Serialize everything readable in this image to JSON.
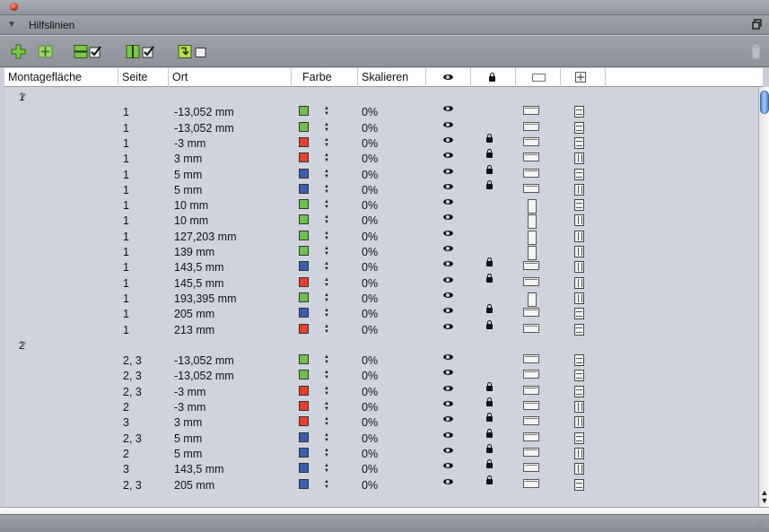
{
  "panel": {
    "title": "Hilfslinien"
  },
  "columns": {
    "montage": "Montagefläche",
    "seite": "Seite",
    "ort": "Ort",
    "farbe": "Farbe",
    "skalieren": "Skalieren",
    "view_icon": "eye-icon",
    "lock_icon": "lock-icon",
    "orient_icon": "orientation-icon",
    "spread_icon": "spread-icon"
  },
  "colors": {
    "green": "#6cc24a",
    "red": "#e8402a",
    "blue": "#3a5eb0"
  },
  "groups": [
    {
      "label": "1",
      "rows": [
        {
          "seite": "1",
          "ort": "-13,052 mm",
          "color": "green",
          "scale": "0%",
          "lock": false,
          "ori": "h",
          "spr": "h"
        },
        {
          "seite": "1",
          "ort": "-13,052 mm",
          "color": "green",
          "scale": "0%",
          "lock": false,
          "ori": "h",
          "spr": "h"
        },
        {
          "seite": "1",
          "ort": "-3 mm",
          "color": "red",
          "scale": "0%",
          "lock": true,
          "ori": "h",
          "spr": "h"
        },
        {
          "seite": "1",
          "ort": "3 mm",
          "color": "red",
          "scale": "0%",
          "lock": true,
          "ori": "h",
          "spr": "v"
        },
        {
          "seite": "1",
          "ort": "5 mm",
          "color": "blue",
          "scale": "0%",
          "lock": true,
          "ori": "h",
          "spr": "h"
        },
        {
          "seite": "1",
          "ort": "5 mm",
          "color": "blue",
          "scale": "0%",
          "lock": true,
          "ori": "h",
          "spr": "v"
        },
        {
          "seite": "1",
          "ort": "10 mm",
          "color": "green",
          "scale": "0%",
          "lock": false,
          "ori": "v",
          "spr": "h"
        },
        {
          "seite": "1",
          "ort": "10 mm",
          "color": "green",
          "scale": "0%",
          "lock": false,
          "ori": "v",
          "spr": "v"
        },
        {
          "seite": "1",
          "ort": "127,203 mm",
          "color": "green",
          "scale": "0%",
          "lock": false,
          "ori": "v",
          "spr": "v"
        },
        {
          "seite": "1",
          "ort": "139 mm",
          "color": "green",
          "scale": "0%",
          "lock": false,
          "ori": "v",
          "spr": "v"
        },
        {
          "seite": "1",
          "ort": "143,5 mm",
          "color": "blue",
          "scale": "0%",
          "lock": true,
          "ori": "h",
          "spr": "v"
        },
        {
          "seite": "1",
          "ort": "145,5 mm",
          "color": "red",
          "scale": "0%",
          "lock": true,
          "ori": "h",
          "spr": "v"
        },
        {
          "seite": "1",
          "ort": "193,395 mm",
          "color": "green",
          "scale": "0%",
          "lock": false,
          "ori": "v",
          "spr": "v"
        },
        {
          "seite": "1",
          "ort": "205 mm",
          "color": "blue",
          "scale": "0%",
          "lock": true,
          "ori": "h",
          "spr": "h"
        },
        {
          "seite": "1",
          "ort": "213 mm",
          "color": "red",
          "scale": "0%",
          "lock": true,
          "ori": "h",
          "spr": "h"
        }
      ]
    },
    {
      "label": "2",
      "rows": [
        {
          "seite": "2, 3",
          "ort": "-13,052 mm",
          "color": "green",
          "scale": "0%",
          "lock": false,
          "ori": "h",
          "spr": "h"
        },
        {
          "seite": "2, 3",
          "ort": "-13,052 mm",
          "color": "green",
          "scale": "0%",
          "lock": false,
          "ori": "h",
          "spr": "h"
        },
        {
          "seite": "2, 3",
          "ort": "-3 mm",
          "color": "red",
          "scale": "0%",
          "lock": true,
          "ori": "h",
          "spr": "h"
        },
        {
          "seite": "2",
          "ort": "-3 mm",
          "color": "red",
          "scale": "0%",
          "lock": true,
          "ori": "h",
          "spr": "v"
        },
        {
          "seite": "3",
          "ort": "3 mm",
          "color": "red",
          "scale": "0%",
          "lock": true,
          "ori": "h",
          "spr": "v"
        },
        {
          "seite": "2, 3",
          "ort": "5 mm",
          "color": "blue",
          "scale": "0%",
          "lock": true,
          "ori": "h",
          "spr": "h"
        },
        {
          "seite": "2",
          "ort": "5 mm",
          "color": "blue",
          "scale": "0%",
          "lock": true,
          "ori": "h",
          "spr": "v"
        },
        {
          "seite": "3",
          "ort": "143,5 mm",
          "color": "blue",
          "scale": "0%",
          "lock": true,
          "ori": "h",
          "spr": "v"
        },
        {
          "seite": "2, 3",
          "ort": "205 mm",
          "color": "blue",
          "scale": "0%",
          "lock": true,
          "ori": "h",
          "spr": "h"
        }
      ]
    }
  ],
  "toolbar": {
    "add_icon": "add-guide-icon",
    "distribute_icon": "distribute-icon",
    "horizontal_icon": "horizontal-guides-icon",
    "vertical_icon": "vertical-guides-icon",
    "snap_icon": "snap-icon",
    "delete_icon": "trash-icon"
  }
}
